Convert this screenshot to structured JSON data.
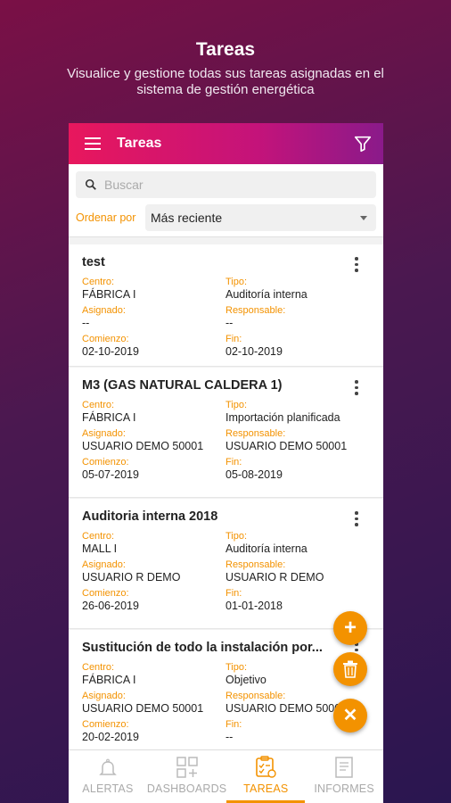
{
  "promo": {
    "title": "Tareas",
    "subtitle_line1": "Visualice y gestione todas sus tareas asignadas en el",
    "subtitle_line2": "sistema de gestión energética"
  },
  "appbar": {
    "title": "Tareas",
    "menu_icon": "menu-icon",
    "filter_icon": "filter-icon"
  },
  "search": {
    "placeholder": "Buscar"
  },
  "sort": {
    "label": "Ordenar por",
    "value": "Más reciente"
  },
  "labels": {
    "centro": "Centro:",
    "tipo": "Tipo:",
    "asignado": "Asignado:",
    "responsable": "Responsable:",
    "comienzo": "Comienzo:",
    "fin": "Fin:"
  },
  "tasks": [
    {
      "title": "test",
      "centro": "FÁBRICA I",
      "tipo": "Auditoría interna",
      "asignado": "--",
      "responsable": "--",
      "comienzo": "02-10-2019",
      "fin": "02-10-2019"
    },
    {
      "title": "M3 (GAS NATURAL CALDERA 1)",
      "centro": "FÁBRICA I",
      "tipo": "Importación planificada",
      "asignado": "USUARIO DEMO 50001",
      "responsable": "USUARIO DEMO 50001",
      "comienzo": "05-07-2019",
      "fin": "05-08-2019"
    },
    {
      "title": "Auditoria interna 2018",
      "centro": "MALL I",
      "tipo": "Auditoría interna",
      "asignado": "USUARIO R DEMO",
      "responsable": "USUARIO R DEMO",
      "comienzo": "26-06-2019",
      "fin": "01-01-2018"
    },
    {
      "title": "Sustitución de todo la instalación por...",
      "centro": "FÁBRICA I",
      "tipo": "Objetivo",
      "asignado": "USUARIO DEMO 50001",
      "responsable": "USUARIO DEMO 50001",
      "comienzo": "20-02-2019",
      "fin": "--"
    }
  ],
  "fabs": {
    "add": "+",
    "delete_icon": "trash-icon",
    "close": "✕"
  },
  "nav": [
    {
      "label": "ALERTAS",
      "icon": "bell-icon"
    },
    {
      "label": "DASHBOARDS",
      "icon": "dashboard-icon"
    },
    {
      "label": "TAREAS",
      "icon": "tasks-icon",
      "active": true
    },
    {
      "label": "INFORMES",
      "icon": "report-icon"
    }
  ],
  "colors": {
    "accent": "#f39200",
    "appbar_start": "#e8175d",
    "appbar_end": "#8a1a8a"
  }
}
